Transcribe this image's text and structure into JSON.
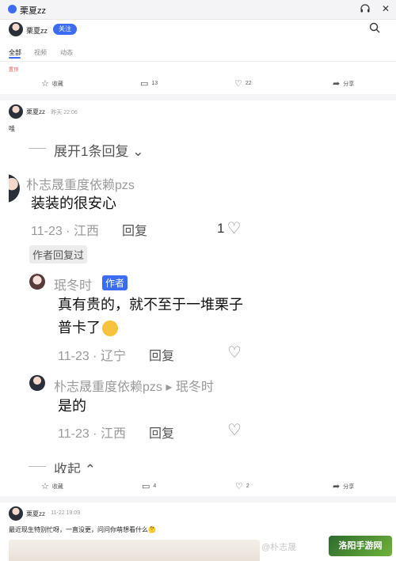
{
  "window": {
    "title": "栗夏zz",
    "headphone_icon": "headphone-icon",
    "close_glyph": "✕"
  },
  "profile": {
    "name": "栗夏zz",
    "follow_label": "关注"
  },
  "tabs": [
    {
      "label": "全部"
    },
    {
      "label": "视频"
    },
    {
      "label": "动态"
    }
  ],
  "post1": {
    "tag_text": "置顶",
    "actions": {
      "collect": "收藏",
      "comments": "13",
      "likes": "22",
      "share": "分享"
    }
  },
  "post2": {
    "author": "栗夏zz",
    "meta": "· 昨天 22:06",
    "text": "哇",
    "shot": {
      "expand": "展开1条回复",
      "c1_name": "朴志晟重度依赖pzs",
      "c1_text": "装装的很安心",
      "c1_meta": "11-23 · 江西",
      "c1_reply": "回复",
      "c1_likes": "1",
      "author_replied": "作者回复过",
      "c2_name": "珉冬时",
      "c2_badge": "作者",
      "c2_text_line1": "真有贵的，就不至于一堆栗子",
      "c2_text_line2": "普卡了",
      "c2_meta": "11-23 · 辽宁",
      "c2_reply": "回复",
      "c3_name": "朴志晟重度依赖pzs ▸ 珉冬时",
      "c3_text": "是的",
      "c3_meta": "11-23 · 江西",
      "c3_reply": "回复",
      "collapse": "收起"
    },
    "actions": {
      "collect": "收藏",
      "comments": "4",
      "likes": "2",
      "share": "分享"
    }
  },
  "post3": {
    "author": "栗夏zz",
    "meta": "· 11-22 19:09",
    "text": "最近现生特别忙呀，一直没更，问问你萌想看什么🤔"
  },
  "watermark": {
    "text": "@朴志晟",
    "site": "洛阳手游网"
  }
}
